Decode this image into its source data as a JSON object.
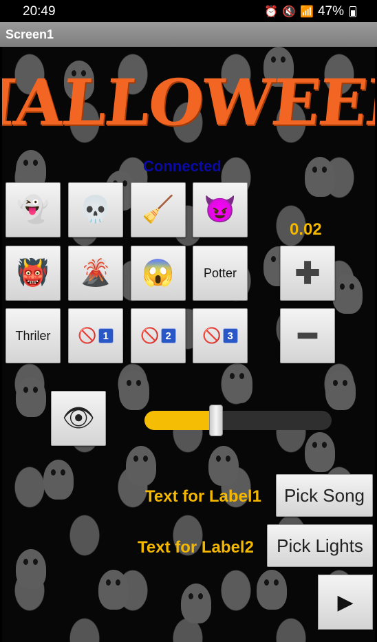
{
  "status_bar": {
    "time": "20:49",
    "battery": "47%",
    "icons": [
      "alarm-icon",
      "mute-icon",
      "wifi-icon",
      "signal-icon",
      "battery-icon"
    ]
  },
  "app": {
    "title": "Screen1"
  },
  "logo": {
    "text": "HALLOWEEN",
    "color": "#f26522"
  },
  "connection_status": "Connected",
  "value_display": "0.02",
  "grid_buttons": {
    "ghost": "👻",
    "skull": "💀",
    "broom": "🧹",
    "devil": "😈",
    "ogre": "👹",
    "volcano": "🌋",
    "scream": "😱",
    "potter": "Potter",
    "thriler": "Thriler",
    "no1": "1",
    "no2": "2",
    "no3": "3",
    "no_symbol": "🚫",
    "plus": "✚",
    "minus": "━"
  },
  "eye_button": "👁",
  "slider": {
    "value_fraction": 0.38,
    "fill_color": "#f5be05"
  },
  "label1": "Text for Label1",
  "label2": "Text for Label2",
  "pick_song": "Pick Song",
  "pick_lights": "Pick Lights",
  "play_button": "▶"
}
